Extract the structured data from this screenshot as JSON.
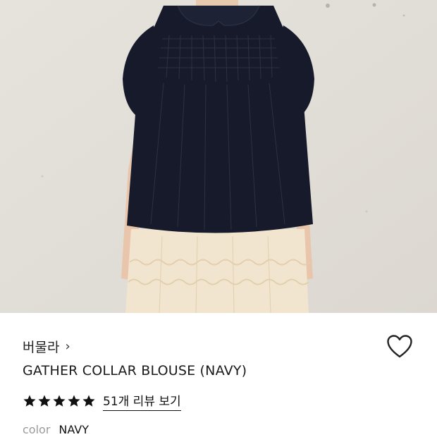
{
  "product": {
    "brand": "버물라",
    "brand_chevron": "›",
    "title": "GATHER COLLAR BLOUSE (NAVY)",
    "rating": {
      "stars": 5,
      "max": 5,
      "review_link": "51개 리뷰 보기"
    },
    "color_label": "color",
    "color_value": "NAVY"
  },
  "icons": {
    "wishlist": "heart-outline-icon",
    "star": "star-filled-icon"
  },
  "colors": {
    "blouse": "#161a2b",
    "skirt": "#f1e5cf",
    "background": "#e4e1db",
    "text": "#111111",
    "muted": "#9a9a9a"
  }
}
